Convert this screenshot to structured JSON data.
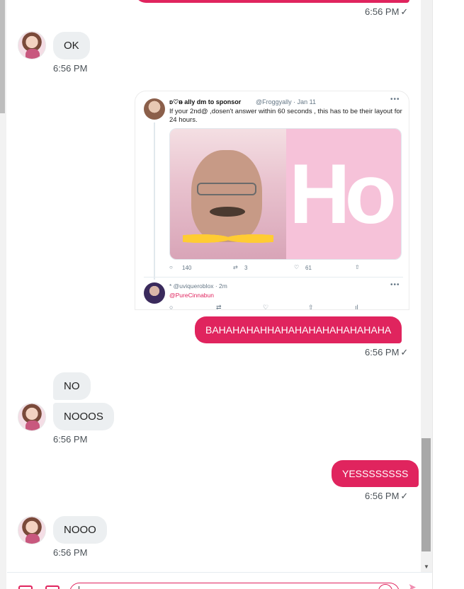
{
  "messages": {
    "top_out_time": "6:56 PM",
    "ok_text": "OK",
    "ok_time": "6:56 PM",
    "tweet": {
      "name": "ᴅ♡ᴃ ally dm to sponsor",
      "handle": "@Froggyally · Jan 11",
      "text": "If your 2nd@ ,dosen't answer within 60 seconds , this has to be their layout for 24 hours.",
      "media_text": "Ho",
      "reply_count": "140",
      "retweet_count": "3",
      "like_count": "61",
      "reply_handle": "* @uviqueroblox · 2m",
      "reply_mention": "@PureCinnabun"
    },
    "bahaha_text": "BAHAHAHAHHAHAHAHAHAHAHAHAHA",
    "bahaha_time": "6:56 PM",
    "no_text": "NO",
    "nooos_text": "NOOOS",
    "no_time": "6:56 PM",
    "yes_text": "YESSSSSSSS",
    "yes_time": "6:56 PM",
    "nooo_text": "NOOO",
    "nooo_time": "6:56 PM"
  },
  "icons": {
    "check": "✓",
    "more": "•••",
    "scroll_down": "▼",
    "send": "➤"
  },
  "colors": {
    "accent": "#e0245e",
    "incoming_bubble": "#eceff1"
  }
}
